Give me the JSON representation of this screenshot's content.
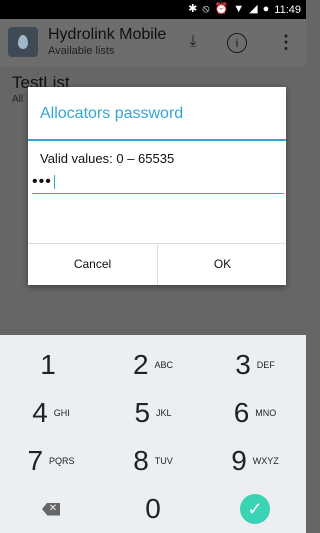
{
  "status_bar": {
    "time": "11:49",
    "icons": [
      "bluetooth-icon",
      "do-not-disturb-icon",
      "alarm-icon",
      "wifi-icon",
      "signal-icon",
      "battery-icon"
    ]
  },
  "app_bar": {
    "title": "Hydrolink Mobile",
    "subtitle": "Available lists"
  },
  "list": {
    "item_title": "TestList",
    "item_sub": "All"
  },
  "dialog": {
    "title": "Allocators password",
    "message": "Valid values: 0 – 65535",
    "password_value": "•••",
    "cancel_label": "Cancel",
    "ok_label": "OK",
    "accent_color": "#33a6d6"
  },
  "keypad": {
    "keys": [
      {
        "num": "1",
        "letters": ""
      },
      {
        "num": "2",
        "letters": "ABC"
      },
      {
        "num": "3",
        "letters": "DEF"
      },
      {
        "num": "4",
        "letters": "GHI"
      },
      {
        "num": "5",
        "letters": "JKL"
      },
      {
        "num": "6",
        "letters": "MNO"
      },
      {
        "num": "7",
        "letters": "PQRS"
      },
      {
        "num": "8",
        "letters": "TUV"
      },
      {
        "num": "9",
        "letters": "WXYZ"
      },
      {
        "num": "0",
        "letters": ""
      }
    ],
    "done_color": "#3ad3b4"
  }
}
